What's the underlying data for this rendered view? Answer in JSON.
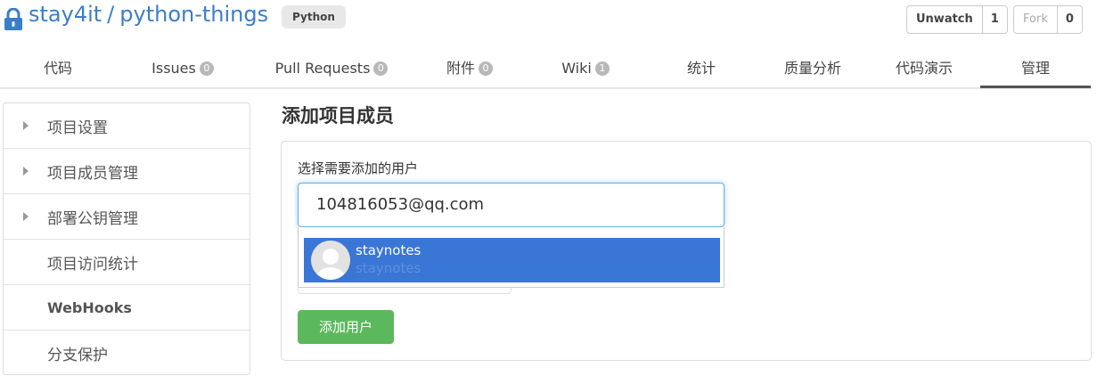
{
  "repo": {
    "owner": "stay4it",
    "separator": "/",
    "name": "python-things",
    "language": "Python"
  },
  "actions": {
    "unwatch_label": "Unwatch",
    "unwatch_count": "1",
    "fork_label": "Fork",
    "fork_count": "0"
  },
  "tabs": [
    {
      "label": "代码"
    },
    {
      "label": "Issues",
      "badge": "0"
    },
    {
      "label": "Pull Requests",
      "badge": "0"
    },
    {
      "label": "附件",
      "badge": "0"
    },
    {
      "label": "Wiki",
      "badge": "1"
    },
    {
      "label": "统计"
    },
    {
      "label": "质量分析"
    },
    {
      "label": "代码演示"
    },
    {
      "label": "管理"
    }
  ],
  "sidebar": {
    "items": [
      {
        "label": "项目设置"
      },
      {
        "label": "项目成员管理"
      },
      {
        "label": "部署公钥管理"
      },
      {
        "label": "项目访问统计"
      },
      {
        "label": "WebHooks"
      },
      {
        "label": "分支保护"
      }
    ]
  },
  "main": {
    "title": "添加项目成员",
    "field_label": "选择需要添加的用户",
    "input_value": "104816053@qq.com",
    "suggestion": {
      "name": "staynotes",
      "sub": "staynotes"
    },
    "submit_label": "添加用户"
  },
  "colors": {
    "link": "#3b7ec8",
    "selection": "#3a76d6",
    "primary_button": "#5cb85c"
  }
}
